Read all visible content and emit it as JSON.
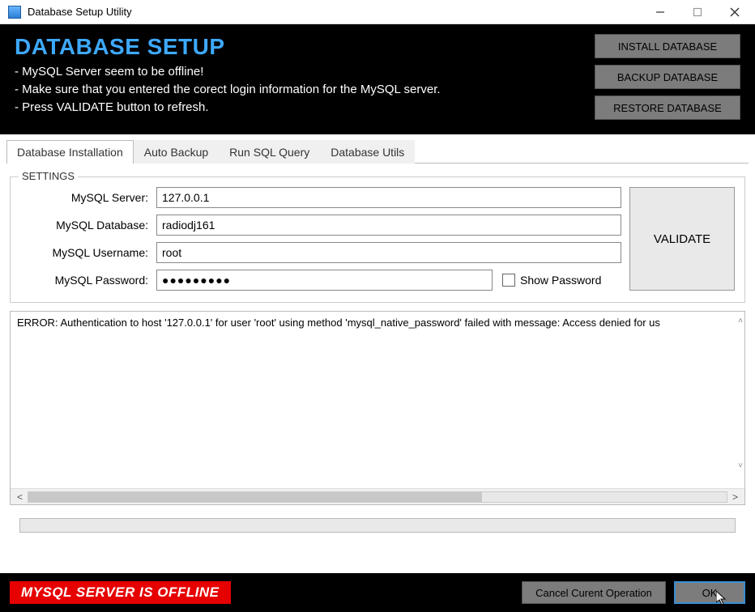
{
  "window": {
    "title": "Database Setup Utility"
  },
  "header": {
    "title": "DATABASE SETUP",
    "lines": [
      "- MySQL Server seem to be offline!",
      "- Make sure that you entered the corect login information for the MySQL server.",
      "- Press VALIDATE button to refresh."
    ],
    "buttons": {
      "install": "INSTALL DATABASE",
      "backup": "BACKUP DATABASE",
      "restore": "RESTORE DATABASE"
    }
  },
  "tabs": [
    {
      "label": "Database Installation",
      "active": true
    },
    {
      "label": "Auto Backup",
      "active": false
    },
    {
      "label": "Run SQL Query",
      "active": false
    },
    {
      "label": "Database Utils",
      "active": false
    }
  ],
  "settings": {
    "legend": "SETTINGS",
    "server_label": "MySQL Server:",
    "server_value": "127.0.0.1",
    "database_label": "MySQL Database:",
    "database_value": "radiodj161",
    "username_label": "MySQL Username:",
    "username_value": "root",
    "password_label": "MySQL Password:",
    "password_value": "●●●●●●●●●",
    "show_password_label": "Show Password",
    "validate_label": "VALIDATE"
  },
  "log": {
    "text": "ERROR: Authentication to host '127.0.0.1' for user 'root' using method 'mysql_native_password' failed with message: Access denied for us"
  },
  "footer": {
    "status": "MYSQL SERVER IS OFFLINE",
    "cancel_label": "Cancel Curent Operation",
    "ok_label": "OK"
  }
}
